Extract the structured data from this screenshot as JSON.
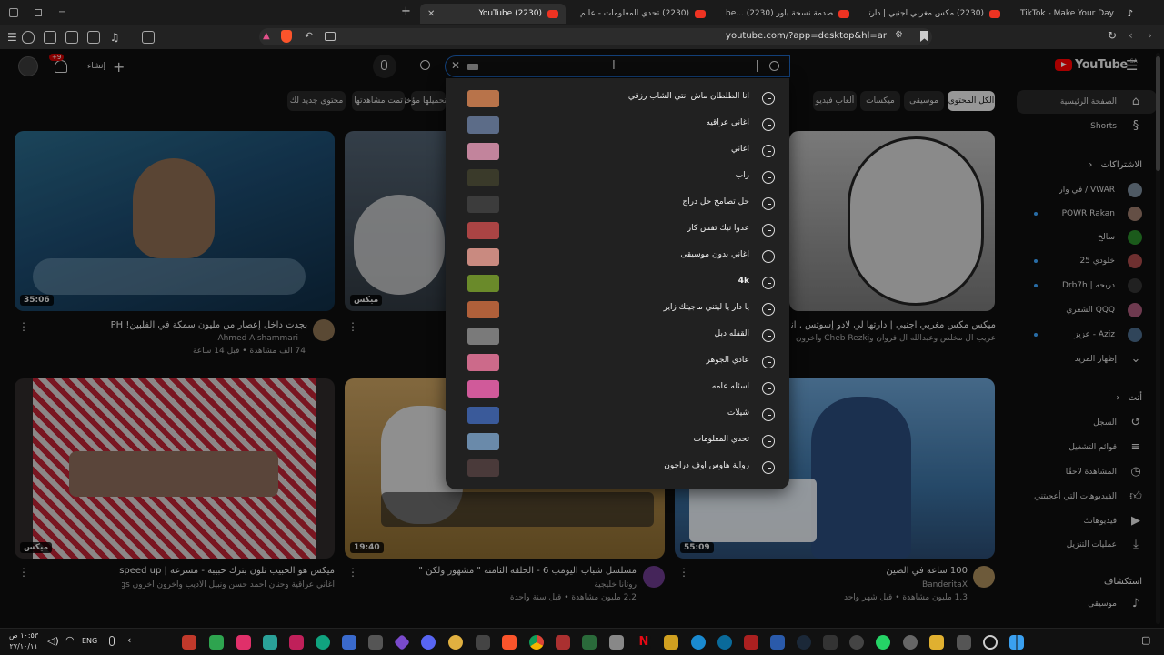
{
  "browser": {
    "tabs": [
      {
        "label": "TikTok - Make Your Day"
      },
      {
        "label": "(2230) مكس مغربي اجنبي | دارتها لي ل..."
      },
      {
        "label": "be... (2230) برنامج الصدمة نسخة باور ! -"
      },
      {
        "label": "(2230) تحدي المعلومات - عالم الصحافة"
      },
      {
        "label": "(2230) YouTube"
      }
    ],
    "url": "youtube.com/?app=desktop&hl=ar"
  },
  "header": {
    "logo_text": "YouTube",
    "country": "SA",
    "create_label": "إنشاء",
    "notif_count": "+9"
  },
  "search": {
    "query": "",
    "suggestions": [
      {
        "text": "انا الطلطان ماش انتي الشاب رزقي",
        "thumb": "#b8734a"
      },
      {
        "text": "اغاني عراقيه",
        "thumb": "#5c6c88"
      },
      {
        "text": "اغاني",
        "thumb": "#c2849c"
      },
      {
        "text": "راب",
        "thumb": "#3a3a2a"
      },
      {
        "text": "حل تصامح حل دراج",
        "thumb": "#3c3c3c"
      },
      {
        "text": "عدوا نيك تفس كار",
        "thumb": "#a44"
      },
      {
        "text": "اغاني بدون موسيقى",
        "thumb": "#c98a80"
      },
      {
        "text": "4k",
        "thumb": "#6a8a2a"
      },
      {
        "text": "يا دار يا ليتني ماجيتك زاير",
        "thumb": "#b0603a"
      },
      {
        "text": "القفله دبل",
        "thumb": "#7a7a7a"
      },
      {
        "text": "عادي الجوهر",
        "thumb": "#cc6a8a"
      },
      {
        "text": "اسئله عامه",
        "thumb": "#d05a9a"
      },
      {
        "text": "شيلات",
        "thumb": "#3a5a9a"
      },
      {
        "text": "تحدي المعلومات",
        "thumb": "#6a8aaa"
      },
      {
        "text": "رواية هاوس اوف دراجون",
        "thumb": "#4a3a3a"
      }
    ]
  },
  "chips": [
    {
      "label": "الكل المحتوى",
      "selected": true
    },
    {
      "label": "موسيقى"
    },
    {
      "label": "ميكسات"
    },
    {
      "label": "ألعاب فيديو"
    },
    {
      "label": "تم تحميلها مؤخرًا"
    },
    {
      "label": "تمت مشاهدتها"
    },
    {
      "label": "محتوى جديد لك"
    }
  ],
  "videos": [
    {
      "title": "بجدت داخل إعصار من مليون سمكة في الفلبين! PH",
      "channel": "Ahmed Alshammari",
      "meta": "74 ألف مشاهدة • قبل 14 ساعة",
      "duration": "35:06"
    },
    {
      "title": "ميكس مكس مغربي اجنبي | دارتها لي لادو إسوتس , انا الطلطان م...",
      "channel": "",
      "meta": "عريب آل مخلص وعبدالله آل فروان وCheb Rezki وآخرون",
      "duration": "ميكس"
    },
    {
      "title": "ميكس هو الحبيب تلون بترك حبيبه - مسرعه | speed up",
      "channel": "",
      "meta": "اغاني عراقية وحنان أحمد حسن ونبيل الأديب وآخرون آخرون Iraqi Songs -",
      "duration": "ميكس"
    },
    {
      "title": "مسلسل شباب اليومب 6 - الحلقة الثامنة \" مشهور ولكن \"",
      "channel": "روتانا خليجية",
      "meta": "2.2 مليون مشاهدة • قبل سنة واحدة",
      "duration": "19:40"
    },
    {
      "title": "100 ساعة في الصين",
      "channel": "BanderitaX",
      "meta": "1.3 مليون مشاهدة • قبل شهر واحد",
      "duration": "55:09"
    }
  ],
  "sidebar": {
    "home": "الصفحة الرئيسية",
    "shorts": "Shorts",
    "subs_header": "الاشتراكات",
    "subs": [
      {
        "label": "في وار / VWAR",
        "color": "#7a8a9a"
      },
      {
        "label": "POWR Rakan",
        "color": "#9a7a6a",
        "dot": true
      },
      {
        "label": "سالخ",
        "color": "#2a8a2a"
      },
      {
        "label": "خلودي 25",
        "color": "#aa4a4a",
        "dot": true
      },
      {
        "label": "Drb7h | دربحه",
        "color": "#333",
        "dot": true
      },
      {
        "label": "الشغري QQQ",
        "color": "#aa5a7a"
      },
      {
        "label": "عزيز - Aziz",
        "color": "#4a6a8a",
        "dot": true
      }
    ],
    "show_more": "إظهار المزيد",
    "you_header": "أنت",
    "you_items": [
      {
        "label": "السجل",
        "icon": "history-icon"
      },
      {
        "label": "قوائم التشغيل",
        "icon": "playlist-icon"
      },
      {
        "label": "المشاهدة لاحقًا",
        "icon": "clock-icon"
      },
      {
        "label": "الفيديوهات التي أعجبتني",
        "icon": "like-icon"
      },
      {
        "label": "فيديوهاتك",
        "icon": "video-icon"
      },
      {
        "label": "عمليات التنزيل",
        "icon": "download-icon"
      }
    ],
    "explore_header": "استكشاف",
    "explore_items": [
      {
        "label": "موسيقى",
        "icon": "music-icon"
      }
    ]
  },
  "taskbar": {
    "lang": "ENG",
    "time": "١٠:٥٣ ص",
    "date": "٢٧/١٠/١١"
  }
}
